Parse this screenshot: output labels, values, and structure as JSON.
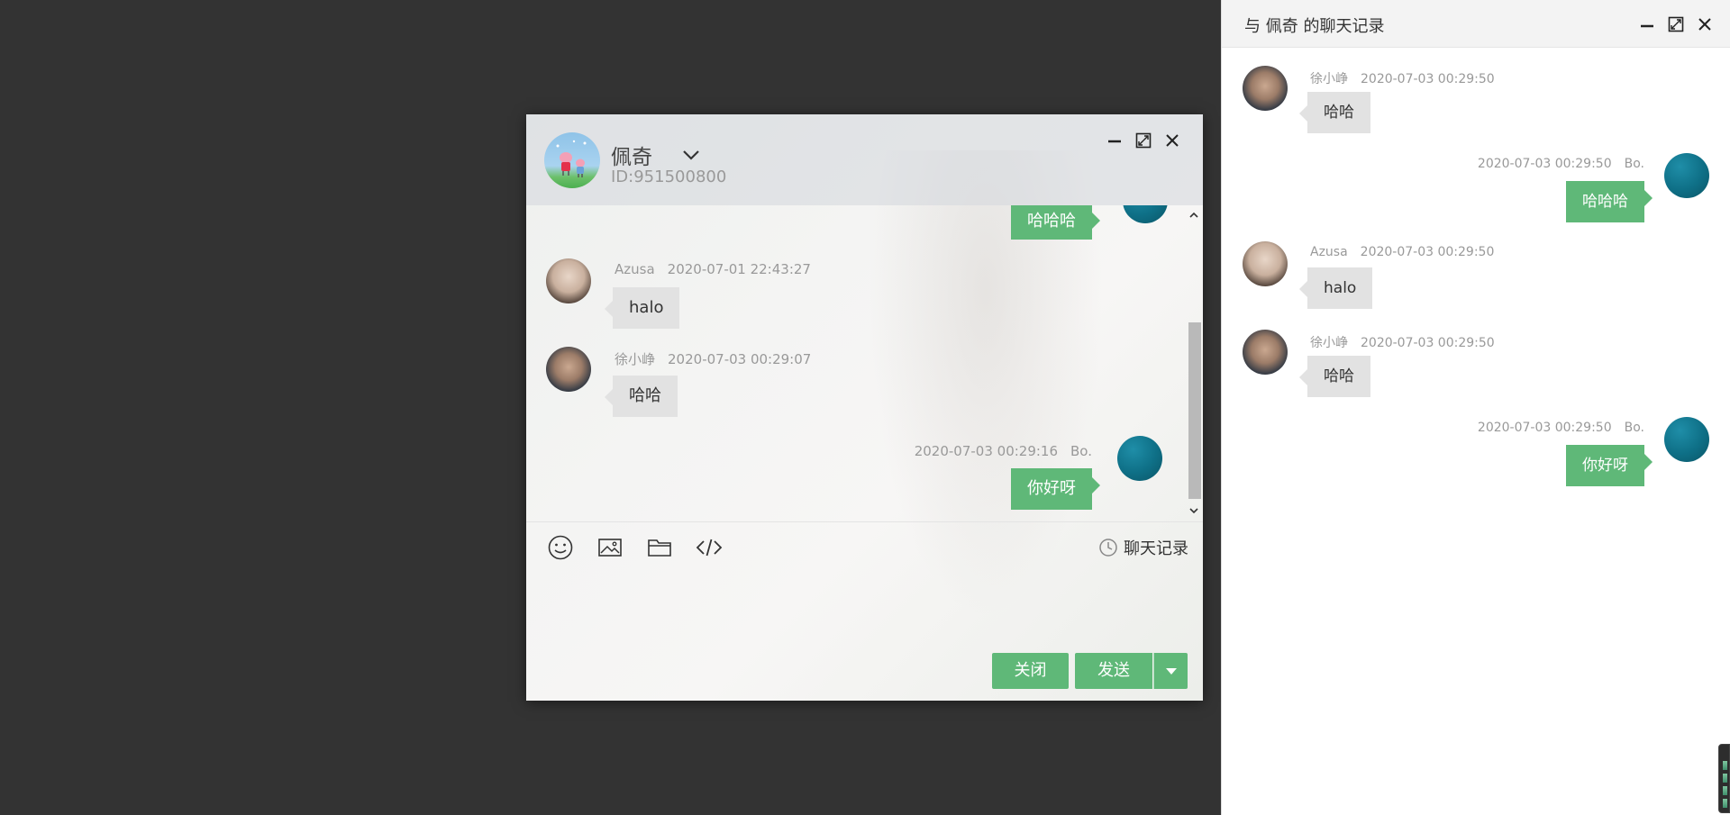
{
  "chat": {
    "peer_name": "佩奇",
    "peer_id": "ID:951500800",
    "messages": [
      {
        "side": "right",
        "text": "哈哈哈",
        "partial": true
      },
      {
        "side": "left",
        "author": "Azusa",
        "time": "2020-07-01 22:43:27",
        "text": "halo"
      },
      {
        "side": "left",
        "author": "徐小峥",
        "time": "2020-07-03 00:29:07",
        "text": "哈哈"
      },
      {
        "side": "right",
        "author": "Bo.",
        "time": "2020-07-03 00:29:16",
        "text": "你好呀"
      }
    ],
    "history_label": "聊天记录",
    "close_label": "关闭",
    "send_label": "发送"
  },
  "history": {
    "title": "与 佩奇 的聊天记录",
    "messages": [
      {
        "side": "left",
        "author": "徐小峥",
        "time": "2020-07-03 00:29:50",
        "text": "哈哈"
      },
      {
        "side": "right",
        "author": "Bo.",
        "time": "2020-07-03 00:29:50",
        "text": "哈哈哈"
      },
      {
        "side": "left",
        "author": "Azusa",
        "time": "2020-07-03 00:29:50",
        "text": "halo"
      },
      {
        "side": "left",
        "author": "徐小峥",
        "time": "2020-07-03 00:29:50",
        "text": "哈哈"
      },
      {
        "side": "right",
        "author": "Bo.",
        "time": "2020-07-03 00:29:50",
        "text": "你好呀"
      }
    ]
  },
  "icons": {
    "emoji": "smiley-icon",
    "image": "image-icon",
    "file": "folder-icon",
    "code": "code-icon",
    "history": "clock-icon",
    "minimize": "minimize-icon",
    "maximize": "maximize-icon",
    "close": "close-icon",
    "dropdown": "chevron-down-icon"
  },
  "colors": {
    "accent": "#5fb878",
    "self_avatar": "#0e6f86",
    "desktop": "#333333"
  }
}
